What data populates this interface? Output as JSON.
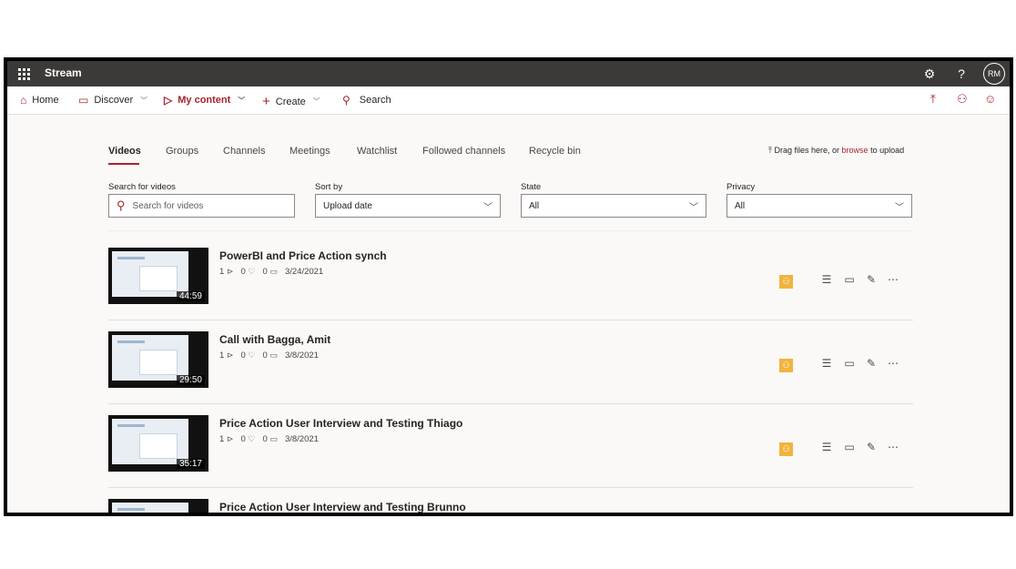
{
  "app": {
    "title": "Stream",
    "avatar_initials": "RM",
    "settings_icon": "gear-icon",
    "help_label": "?"
  },
  "nav": {
    "home": "Home",
    "discover": "Discover",
    "my_content": "My content",
    "create": "Create",
    "search": "Search"
  },
  "tabs": [
    "Videos",
    "Groups",
    "Channels",
    "Meetings",
    "Watchlist",
    "Followed channels",
    "Recycle bin"
  ],
  "upload": {
    "prefix": "Drag files here, or",
    "link": "browse",
    "suffix": "to upload"
  },
  "filters": {
    "search_label": "Search for videos",
    "search_placeholder": "Search for videos",
    "sort_label": "Sort by",
    "sort_value": "Upload date",
    "state_label": "State",
    "state_value": "All",
    "privacy_label": "Privacy",
    "privacy_value": "All"
  },
  "videos": [
    {
      "title": "PowerBI and Price Action synch",
      "duration": "44:59",
      "views": "1",
      "likes": "0",
      "comments": "0",
      "date": "3/24/2021"
    },
    {
      "title": "Call with Bagga, Amit",
      "duration": "29:50",
      "views": "1",
      "likes": "0",
      "comments": "0",
      "date": "3/8/2021"
    },
    {
      "title": "Price Action User Interview and Testing Thiago",
      "duration": "35:17",
      "views": "1",
      "likes": "0",
      "comments": "0",
      "date": "3/8/2021"
    },
    {
      "title": "Price Action User Interview and Testing Brunno",
      "duration": "",
      "views": "",
      "likes": "",
      "comments": "",
      "date": ""
    }
  ],
  "colors": {
    "accent": "#a4262c",
    "topbar": "#3b3a39",
    "badge": "#f2b33d"
  }
}
